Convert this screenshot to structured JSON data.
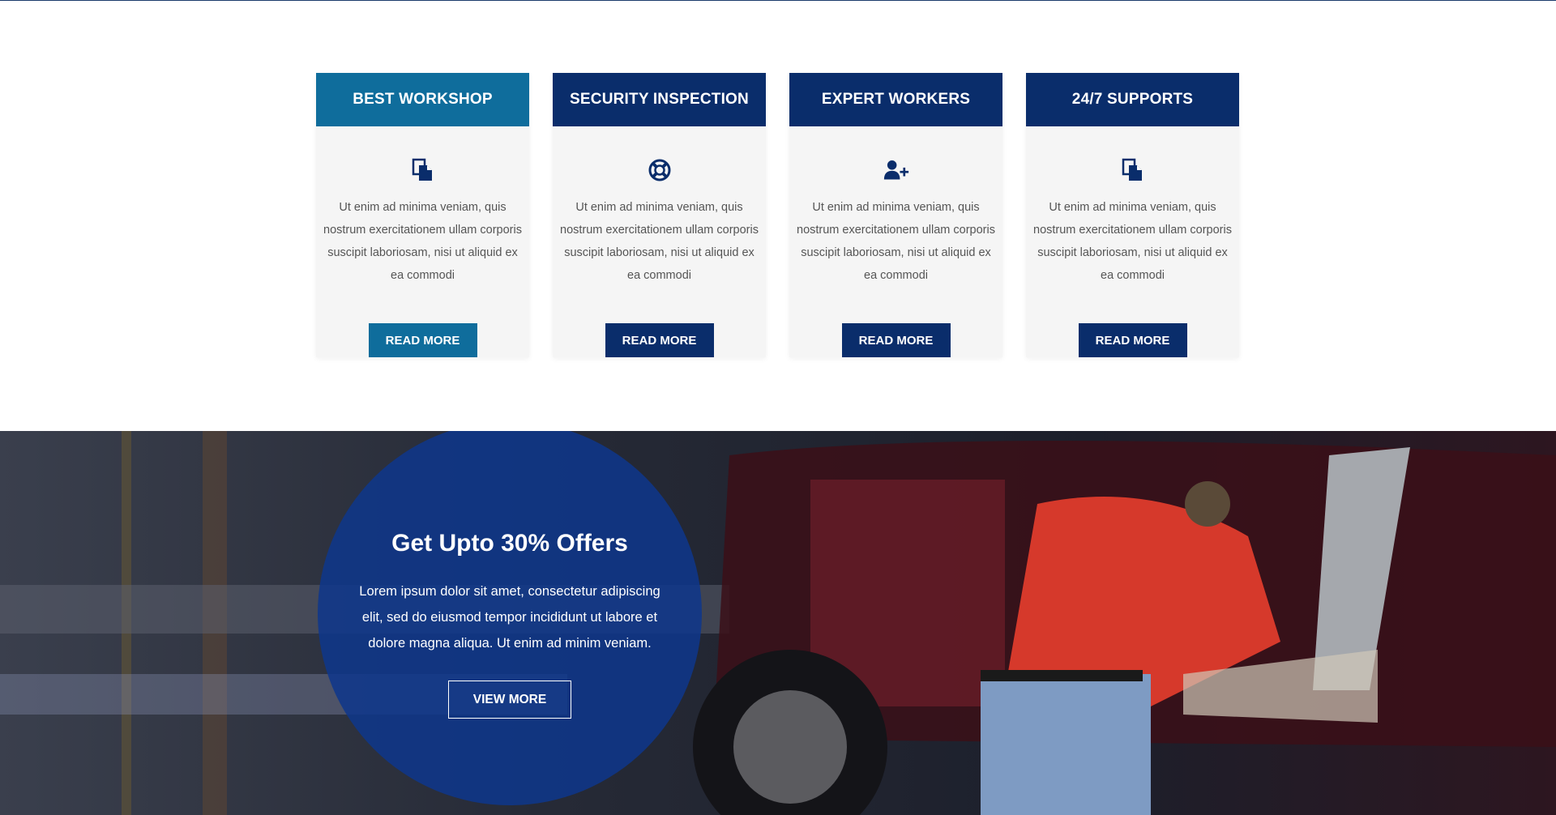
{
  "services": [
    {
      "title": "BEST WORKSHOP",
      "icon": "copy-icon",
      "text": "Ut enim ad minima veniam, quis nostrum exercitationem ullam corporis suscipit laboriosam, nisi ut aliquid ex ea commodi",
      "button": "READ MORE",
      "active": true
    },
    {
      "title": "SECURITY INSPECTION",
      "icon": "life-ring-icon",
      "text": "Ut enim ad minima veniam, quis nostrum exercitationem ullam corporis suscipit laboriosam, nisi ut aliquid ex ea commodi",
      "button": "READ MORE",
      "active": false
    },
    {
      "title": "EXPERT WORKERS",
      "icon": "user-plus-icon",
      "text": "Ut enim ad minima veniam, quis nostrum exercitationem ullam corporis suscipit laboriosam, nisi ut aliquid ex ea commodi",
      "button": "READ MORE",
      "active": false
    },
    {
      "title": "24/7 SUPPORTS",
      "icon": "copy-icon",
      "text": "Ut enim ad minima veniam, quis nostrum exercitationem ullam corporis suscipit laboriosam, nisi ut aliquid ex ea commodi",
      "button": "READ MORE",
      "active": false
    }
  ],
  "offer": {
    "title": "Get Upto 30%  Offers",
    "text": "Lorem ipsum dolor sit amet, consectetur adipiscing elit, sed do eiusmod tempor incididunt ut labore et dolore magna aliqua. Ut enim ad minim veniam.",
    "button": "VIEW MORE"
  },
  "colors": {
    "primary": "#0a2d6b",
    "accent": "#0f6d9c",
    "circle": "#0e378c"
  }
}
